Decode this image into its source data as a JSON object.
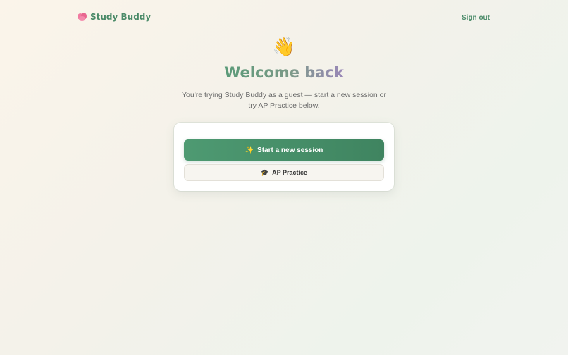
{
  "header": {
    "brand_icon": "brain-icon",
    "brand_name": "Study Buddy",
    "signout_label": "Sign out"
  },
  "hero": {
    "icon": "waving-hand-icon",
    "icon_glyph": "👋",
    "title": "Welcome back",
    "subtitle": "You're trying Study Buddy as a guest — start a new session or try AP Practice below."
  },
  "actions": {
    "primary": {
      "icon": "sparkles-icon",
      "icon_glyph": "✨",
      "label": "Start a new session"
    },
    "secondary": {
      "icon": "graduation-cap-icon",
      "icon_glyph": "🎓",
      "label": "AP Practice"
    }
  },
  "colors": {
    "accent_green": "#4a8a68",
    "button_green": "#4e9a72",
    "title_purple": "#9a88b8",
    "brain_pink": "#f07aa0"
  }
}
